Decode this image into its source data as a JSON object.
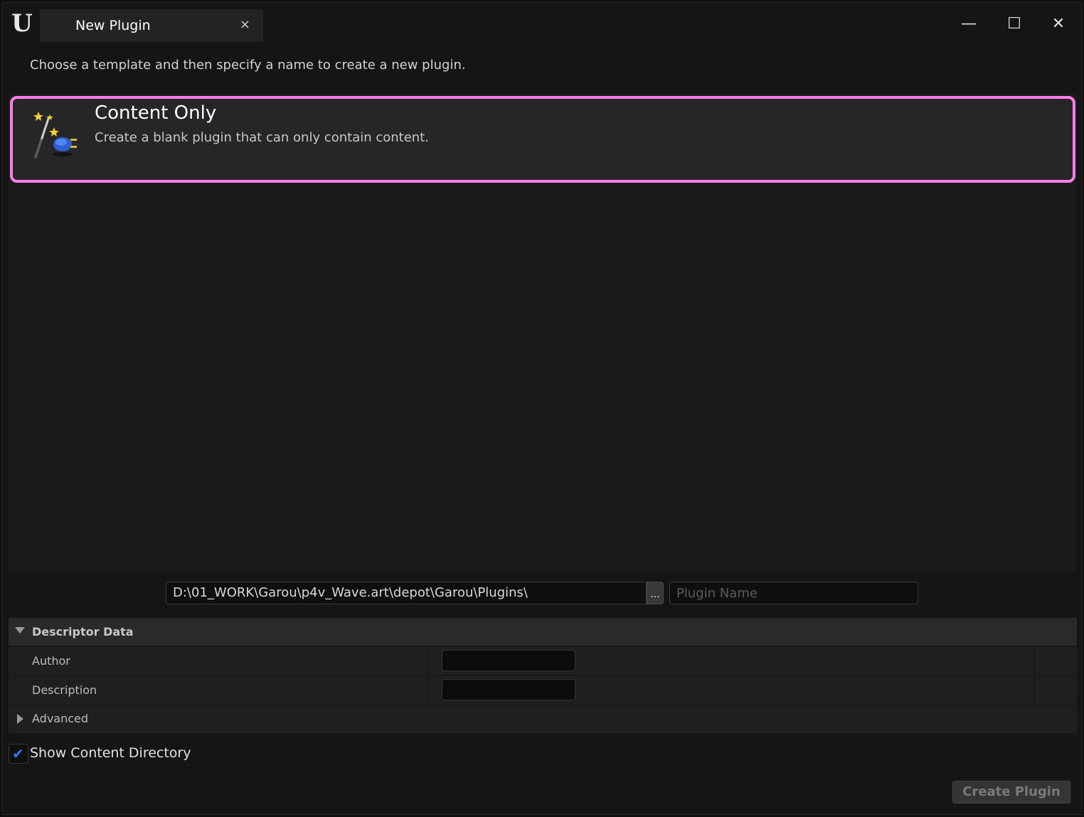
{
  "window": {
    "tab_title": "New Plugin",
    "tab_close": "×",
    "minimize": "—",
    "maximize": "☐",
    "close": "✕"
  },
  "subtitle": "Choose a template and then specify a name to create a new plugin.",
  "templates": [
    {
      "title": "Content Only",
      "description": "Create a blank plugin that can only contain content.",
      "icon": "magic-wand-plugin-icon",
      "selected": true
    }
  ],
  "path": {
    "value": "D:\\01_WORK\\Garou\\p4v_Wave.art\\depot\\Garou\\Plugins\\",
    "browse_label": "...",
    "name_placeholder": "Plugin Name"
  },
  "descriptor": {
    "section_title": "Descriptor Data",
    "author_label": "Author",
    "description_label": "Description",
    "advanced_label": "Advanced"
  },
  "options": {
    "show_content_directory_label": "Show Content Directory",
    "show_content_directory_checked": true
  },
  "actions": {
    "create_label": "Create Plugin"
  },
  "colors": {
    "selection_border": "#ff7eea",
    "check_accent": "#2f7bff"
  }
}
